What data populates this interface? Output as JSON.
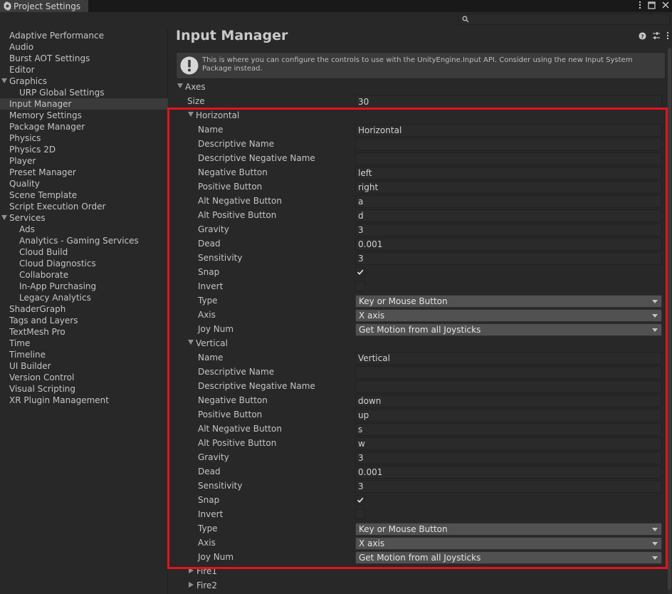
{
  "window": {
    "title": "Project Settings"
  },
  "sidebar": {
    "items": [
      {
        "label": "Adaptive Performance",
        "indent": 0
      },
      {
        "label": "Audio",
        "indent": 0
      },
      {
        "label": "Burst AOT Settings",
        "indent": 0
      },
      {
        "label": "Editor",
        "indent": 0
      },
      {
        "label": "Graphics",
        "indent": 0,
        "expanded": true
      },
      {
        "label": "URP Global Settings",
        "indent": 1
      },
      {
        "label": "Input Manager",
        "indent": 0,
        "selected": true
      },
      {
        "label": "Memory Settings",
        "indent": 0
      },
      {
        "label": "Package Manager",
        "indent": 0
      },
      {
        "label": "Physics",
        "indent": 0
      },
      {
        "label": "Physics 2D",
        "indent": 0
      },
      {
        "label": "Player",
        "indent": 0
      },
      {
        "label": "Preset Manager",
        "indent": 0
      },
      {
        "label": "Quality",
        "indent": 0
      },
      {
        "label": "Scene Template",
        "indent": 0
      },
      {
        "label": "Script Execution Order",
        "indent": 0
      },
      {
        "label": "Services",
        "indent": 0,
        "expanded": true
      },
      {
        "label": "Ads",
        "indent": 1
      },
      {
        "label": "Analytics - Gaming Services",
        "indent": 1
      },
      {
        "label": "Cloud Build",
        "indent": 1
      },
      {
        "label": "Cloud Diagnostics",
        "indent": 1
      },
      {
        "label": "Collaborate",
        "indent": 1
      },
      {
        "label": "In-App Purchasing",
        "indent": 1
      },
      {
        "label": "Legacy Analytics",
        "indent": 1
      },
      {
        "label": "ShaderGraph",
        "indent": 0
      },
      {
        "label": "Tags and Layers",
        "indent": 0
      },
      {
        "label": "TextMesh Pro",
        "indent": 0
      },
      {
        "label": "Time",
        "indent": 0
      },
      {
        "label": "Timeline",
        "indent": 0
      },
      {
        "label": "UI Builder",
        "indent": 0
      },
      {
        "label": "Version Control",
        "indent": 0
      },
      {
        "label": "Visual Scripting",
        "indent": 0
      },
      {
        "label": "XR Plugin Management",
        "indent": 0
      }
    ]
  },
  "main": {
    "title": "Input Manager",
    "help": "This is where you can configure the controls to use with the UnityEngine.Input API. Consider using the new Input System Package instead.",
    "axes_label": "Axes",
    "size_label": "Size",
    "size_value": "30",
    "axes": [
      {
        "name": "Horizontal",
        "fields": [
          {
            "label": "Name",
            "kind": "text",
            "value": "Horizontal"
          },
          {
            "label": "Descriptive Name",
            "kind": "text",
            "value": ""
          },
          {
            "label": "Descriptive Negative Name",
            "kind": "text",
            "value": ""
          },
          {
            "label": "Negative Button",
            "kind": "text",
            "value": "left"
          },
          {
            "label": "Positive Button",
            "kind": "text",
            "value": "right"
          },
          {
            "label": "Alt Negative Button",
            "kind": "text",
            "value": "a"
          },
          {
            "label": "Alt Positive Button",
            "kind": "text",
            "value": "d"
          },
          {
            "label": "Gravity",
            "kind": "text",
            "value": "3"
          },
          {
            "label": "Dead",
            "kind": "text",
            "value": "0.001"
          },
          {
            "label": "Sensitivity",
            "kind": "text",
            "value": "3"
          },
          {
            "label": "Snap",
            "kind": "check",
            "checked": true
          },
          {
            "label": "Invert",
            "kind": "check",
            "checked": false
          },
          {
            "label": "Type",
            "kind": "dropdown",
            "value": "Key or Mouse Button"
          },
          {
            "label": "Axis",
            "kind": "dropdown",
            "value": "X axis"
          },
          {
            "label": "Joy Num",
            "kind": "dropdown",
            "value": "Get Motion from all Joysticks"
          }
        ]
      },
      {
        "name": "Vertical",
        "fields": [
          {
            "label": "Name",
            "kind": "text",
            "value": "Vertical"
          },
          {
            "label": "Descriptive Name",
            "kind": "text",
            "value": ""
          },
          {
            "label": "Descriptive Negative Name",
            "kind": "text",
            "value": ""
          },
          {
            "label": "Negative Button",
            "kind": "text",
            "value": "down"
          },
          {
            "label": "Positive Button",
            "kind": "text",
            "value": "up"
          },
          {
            "label": "Alt Negative Button",
            "kind": "text",
            "value": "s"
          },
          {
            "label": "Alt Positive Button",
            "kind": "text",
            "value": "w"
          },
          {
            "label": "Gravity",
            "kind": "text",
            "value": "3"
          },
          {
            "label": "Dead",
            "kind": "text",
            "value": "0.001"
          },
          {
            "label": "Sensitivity",
            "kind": "text",
            "value": "3"
          },
          {
            "label": "Snap",
            "kind": "check",
            "checked": true
          },
          {
            "label": "Invert",
            "kind": "check",
            "checked": false
          },
          {
            "label": "Type",
            "kind": "dropdown",
            "value": "Key or Mouse Button"
          },
          {
            "label": "Axis",
            "kind": "dropdown",
            "value": "X axis"
          },
          {
            "label": "Joy Num",
            "kind": "dropdown",
            "value": "Get Motion from all Joysticks"
          }
        ]
      }
    ],
    "collapsed_axes": [
      "Fire1",
      "Fire2"
    ]
  },
  "colors": {
    "highlight": "#e0141e",
    "panel": "#282828",
    "field": "#2a2a2a",
    "dropdown": "#515151"
  },
  "icons": [
    "gear-icon",
    "kebab-menu-icon",
    "maximize-icon",
    "close-icon",
    "search-icon",
    "warning-icon",
    "help-icon",
    "preset-icon",
    "more-icon",
    "checkmark-icon"
  ]
}
